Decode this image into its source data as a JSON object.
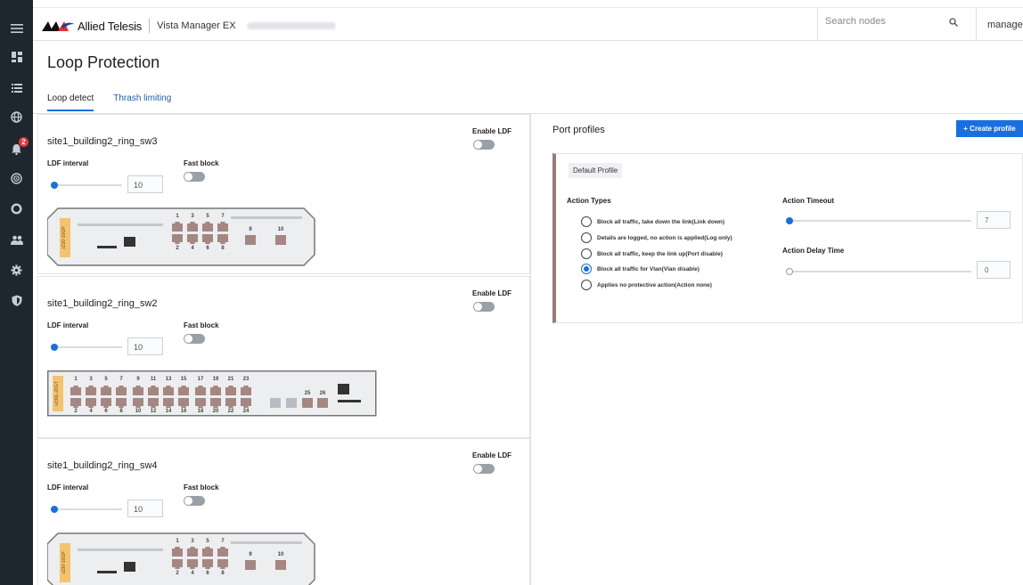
{
  "nav": {
    "items": [
      "menu-icon",
      "dashboard-icon",
      "list-icon",
      "globe-icon",
      "alarm-icon",
      "radar-icon",
      "circle-icon",
      "users-icon",
      "gear-icon",
      "shield-icon"
    ],
    "alarm_count": "2"
  },
  "header": {
    "brand": "Allied Telesis",
    "product": "Vista Manager EX",
    "search_placeholder": "Search nodes",
    "user": "manager"
  },
  "page": {
    "title": "Loop Protection",
    "tabs": [
      "Loop detect",
      "Thrash limiting"
    ],
    "active_tab": "Loop detect"
  },
  "labels": {
    "enable_ldf": "Enable LDF",
    "ldf_interval": "LDF interval",
    "fast_block": "Fast block"
  },
  "switches": [
    {
      "name": "site1_building2_ring_sw3",
      "interval": "10",
      "model": "x230-10GP",
      "enable_ldf": false,
      "fast_block": false
    },
    {
      "name": "site1_building2_ring_sw2",
      "interval": "10",
      "model": "x230L-26GT",
      "enable_ldf": false,
      "fast_block": false
    },
    {
      "name": "site1_building2_ring_sw4",
      "interval": "10",
      "model": "x230-10GP",
      "enable_ldf": false,
      "fast_block": false
    }
  ],
  "device_ports": {
    "sw10_top": [
      "1",
      "3",
      "5",
      "7"
    ],
    "sw10_bottom": [
      "2",
      "4",
      "6",
      "8"
    ],
    "sw10_sfp": [
      "9",
      "10"
    ],
    "sw26_top": [
      "1",
      "3",
      "5",
      "7",
      "9",
      "11",
      "13",
      "15",
      "17",
      "19",
      "21",
      "23"
    ],
    "sw26_bottom": [
      "2",
      "4",
      "6",
      "8",
      "10",
      "12",
      "14",
      "16",
      "18",
      "20",
      "22",
      "24"
    ],
    "sw26_sfp": [
      "25",
      "26"
    ]
  },
  "profiles": {
    "title": "Port profiles",
    "create_label": "+ Create profile",
    "default_profile": {
      "name": "Default Profile",
      "action_types_label": "Action Types",
      "actions": [
        "Block all traffic, take down the link(Link down)",
        "Details are logged, no action is applied(Log only)",
        "Block all traffic, keep the link up(Port disable)",
        "Block all traffic for Vlan(Vlan disable)",
        "Applies no protective action(Action none)"
      ],
      "selected_action_index": 3,
      "action_timeout_label": "Action Timeout",
      "action_timeout": "7",
      "action_delay_label": "Action Delay Time",
      "action_delay": "0"
    }
  },
  "colors": {
    "nav_bg": "#1e2630",
    "accent": "#1a6fe0",
    "port": "#a58680",
    "device_bg": "#eceef0",
    "model_label": "#f5c36b"
  }
}
